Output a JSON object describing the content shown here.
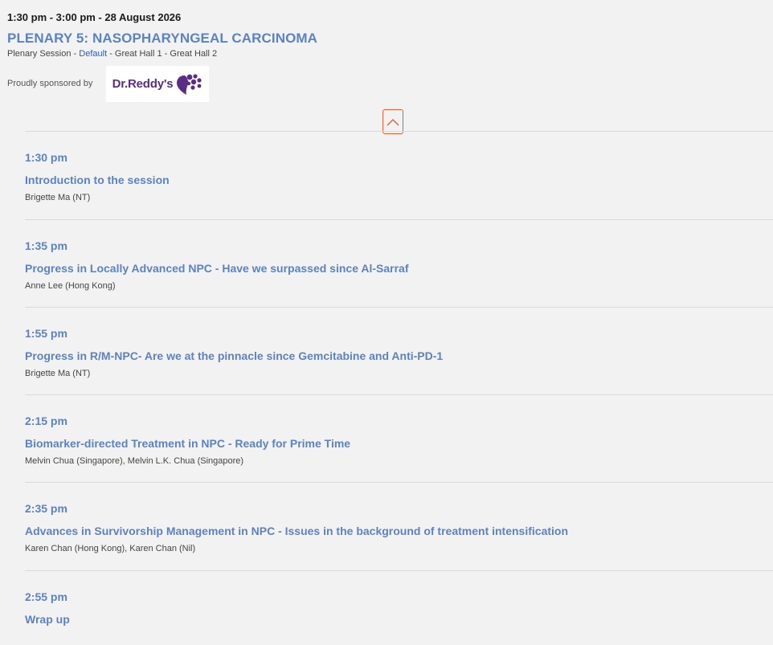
{
  "session": {
    "time": "1:30 pm - 3:00 pm - 28 August 2026",
    "title": "PLENARY 5: NASOPHARYNGEAL CARCINOMA",
    "type": "Plenary Session",
    "sep1": " - ",
    "track": "Default",
    "sep2": " - ",
    "location": "Great Hall 1 - Great Hall 2"
  },
  "sponsor": {
    "label": "Proudly sponsored by",
    "logo_text": "Dr.Reddy's",
    "logo_color": "#5b2c86"
  },
  "collapse": {
    "icon": "chevron-up-icon",
    "color": "#e0603a"
  },
  "accent_color": "#5b83c2",
  "items": [
    {
      "time": "1:30 pm",
      "title": "Introduction to the session",
      "speakers": "Brigette Ma (NT)"
    },
    {
      "time": "1:35 pm",
      "title": "Progress in Locally Advanced NPC - Have we surpassed since Al-Sarraf",
      "speakers": "Anne Lee (Hong Kong)"
    },
    {
      "time": "1:55 pm",
      "title": "Progress in R/M-NPC- Are we at the pinnacle since Gemcitabine and Anti-PD-1",
      "speakers": "Brigette Ma (NT)"
    },
    {
      "time": "2:15 pm",
      "title": "Biomarker-directed Treatment in NPC - Ready for Prime Time",
      "speakers": "Melvin Chua (Singapore), Melvin L.K. Chua (Singapore)"
    },
    {
      "time": "2:35 pm",
      "title": "Advances in Survivorship Management in NPC - Issues in the background of treatment intensification",
      "speakers": "Karen Chan (Hong Kong), Karen Chan (Nil)"
    },
    {
      "time": "2:55 pm",
      "title": "Wrap up",
      "speakers": ""
    }
  ]
}
